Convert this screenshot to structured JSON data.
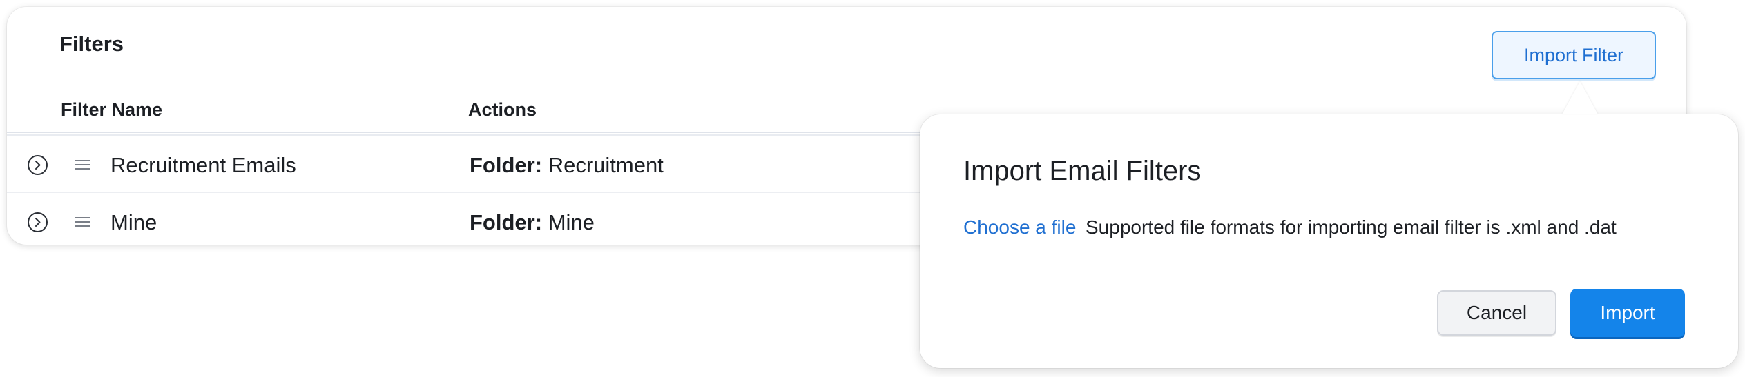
{
  "filters_card": {
    "title": "Filters",
    "columns": {
      "name": "Filter Name",
      "actions": "Actions"
    },
    "rows": [
      {
        "name": "Recruitment Emails",
        "action_label": "Folder:",
        "action_value": "Recruitment"
      },
      {
        "name": "Mine",
        "action_label": "Folder:",
        "action_value": "Mine"
      }
    ],
    "import_filter_button": "Import Filter"
  },
  "import_popover": {
    "title": "Import Email Filters",
    "choose_file_link": "Choose a file",
    "formats_text": "Supported file formats for importing email filter is .xml and .dat",
    "cancel_button": "Cancel",
    "import_button": "Import"
  },
  "icons": {
    "row_expand": "chevron-right-circle-icon",
    "row_drag": "drag-handle-icon"
  },
  "colors": {
    "accent": "#1f6fd1",
    "primary_button": "#1484ea",
    "text": "#1c1f24"
  }
}
